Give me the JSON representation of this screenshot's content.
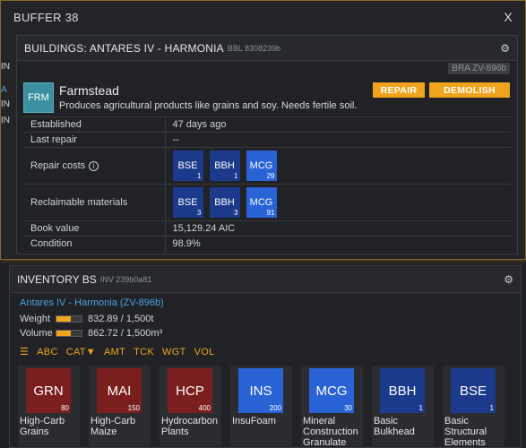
{
  "buffer": {
    "title": "BUFFER 38",
    "close": "X"
  },
  "side_fragments": [
    "IN",
    "A",
    "IN",
    "IN"
  ],
  "buildings": {
    "title": "BUILDINGS: ANTARES IV - HARMONIA",
    "sub": "BBL 8308239b",
    "gear": "⚙",
    "code_badge": "BRA ZV-896b",
    "building": {
      "ticker": "FRM",
      "name": "Farmstead",
      "description": "Produces agricultural products like grains and soy. Needs fertile soil."
    },
    "repair_label": "REPAIR",
    "demolish_label": "DEMOLISH",
    "rows": {
      "established": {
        "key": "Established",
        "value": "47 days ago"
      },
      "last_repair": {
        "key": "Last repair",
        "value": "--"
      },
      "repair_costs": {
        "key": "Repair costs",
        "info": "i"
      },
      "reclaimable": {
        "key": "Reclaimable materials"
      },
      "book_value": {
        "key": "Book value",
        "value": "15,129.24 AIC"
      },
      "condition": {
        "key": "Condition",
        "value": "98.9%"
      }
    },
    "repair_materials": [
      {
        "ticker": "BSE",
        "amount": "1",
        "color": "#1b3a8c"
      },
      {
        "ticker": "BBH",
        "amount": "1",
        "color": "#1b3a8c"
      },
      {
        "ticker": "MCG",
        "amount": "29",
        "color": "#2a63d6"
      }
    ],
    "reclaim_materials": [
      {
        "ticker": "BSE",
        "amount": "3",
        "color": "#1b3a8c"
      },
      {
        "ticker": "BBH",
        "amount": "3",
        "color": "#1b3a8c"
      },
      {
        "ticker": "MCG",
        "amount": "91",
        "color": "#2a63d6"
      }
    ]
  },
  "inventory": {
    "title": "INVENTORY BS",
    "sub": "INV 239b0a81",
    "gear": "⚙",
    "location": "Antares IV - Harmonia (ZV-896b)",
    "weight": {
      "label": "Weight",
      "value": "832.89 / 1,500t",
      "fraction": 0.555
    },
    "volume": {
      "label": "Volume",
      "value": "862.72 / 1,500m³",
      "fraction": 0.575
    },
    "sort": {
      "icon": "☰",
      "abc": "ABC",
      "cat": "CAT▼",
      "amt": "AMT",
      "tck": "TCK",
      "wgt": "WGT",
      "vol": "VOL"
    },
    "items": [
      {
        "ticker": "GRN",
        "amount": "80",
        "name": "High-Carb Grains",
        "color": "#7a1e1e"
      },
      {
        "ticker": "MAI",
        "amount": "150",
        "name": "High-Carb Maize",
        "color": "#7a1e1e"
      },
      {
        "ticker": "HCP",
        "amount": "400",
        "name": "Hydrocarbon Plants",
        "color": "#7a1e1e"
      },
      {
        "ticker": "INS",
        "amount": "200",
        "name": "InsuFoam",
        "color": "#2a63d6"
      },
      {
        "ticker": "MCG",
        "amount": "30",
        "name": "Mineral Construction Granulate",
        "color": "#2a63d6"
      },
      {
        "ticker": "BBH",
        "amount": "1",
        "name": "Basic Bulkhead",
        "color": "#1b3a8c"
      },
      {
        "ticker": "BSE",
        "amount": "1",
        "name": "Basic Structural Elements",
        "color": "#1b3a8c"
      }
    ]
  }
}
